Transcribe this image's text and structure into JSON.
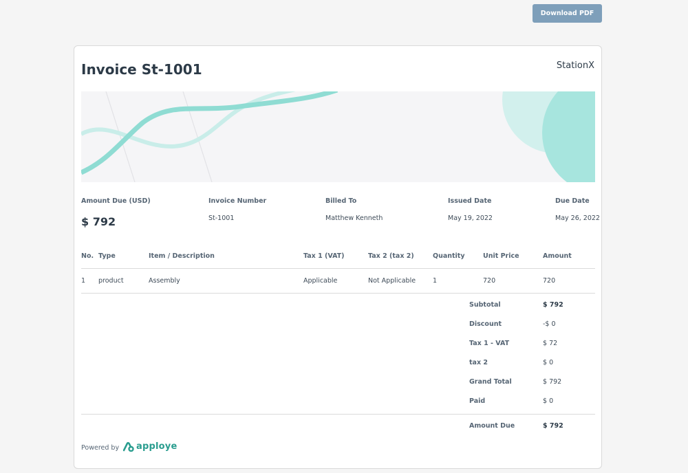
{
  "toolbar": {
    "download_label": "Download PDF"
  },
  "invoice": {
    "title": "Invoice St-1001",
    "brand": "StationX"
  },
  "meta": {
    "amount_due_label": "Amount Due (USD)",
    "amount_due_value": "$ 792",
    "invoice_number_label": "Invoice Number",
    "invoice_number_value": "St-1001",
    "billed_to_label": "Billed To",
    "billed_to_value": "Matthew Kenneth",
    "issued_date_label": "Issued Date",
    "issued_date_value": "May 19, 2022",
    "due_date_label": "Due Date",
    "due_date_value": "May 26, 2022"
  },
  "table": {
    "headers": [
      "No.",
      "Type",
      "Item / Description",
      "Tax 1 (VAT)",
      "Tax 2 (tax 2)",
      "Quantity",
      "Unit Price",
      "Amount"
    ],
    "rows": [
      [
        "1",
        "product",
        "Assembly",
        "Applicable",
        "Not Applicable",
        "1",
        "720",
        "720"
      ]
    ]
  },
  "summary": {
    "subtotal_label": "Subtotal",
    "subtotal_value": "$ 792",
    "discount_label": "Discount",
    "discount_value": "-$ 0",
    "tax1_label": "Tax 1 - VAT",
    "tax1_value": "$ 72",
    "tax2_label": "tax 2",
    "tax2_value": "$ 0",
    "grand_total_label": "Grand Total",
    "grand_total_value": "$ 792",
    "paid_label": "Paid",
    "paid_value": "$ 0",
    "amount_due_label": "Amount Due",
    "amount_due_value": "$ 792"
  },
  "footer": {
    "powered_by": "Powered by",
    "logo_text": "apploye",
    "logo_color": "#2a9d8f"
  },
  "colors": {
    "accent_teal": "#7dd8cf",
    "button_bg": "#7e9fba"
  }
}
